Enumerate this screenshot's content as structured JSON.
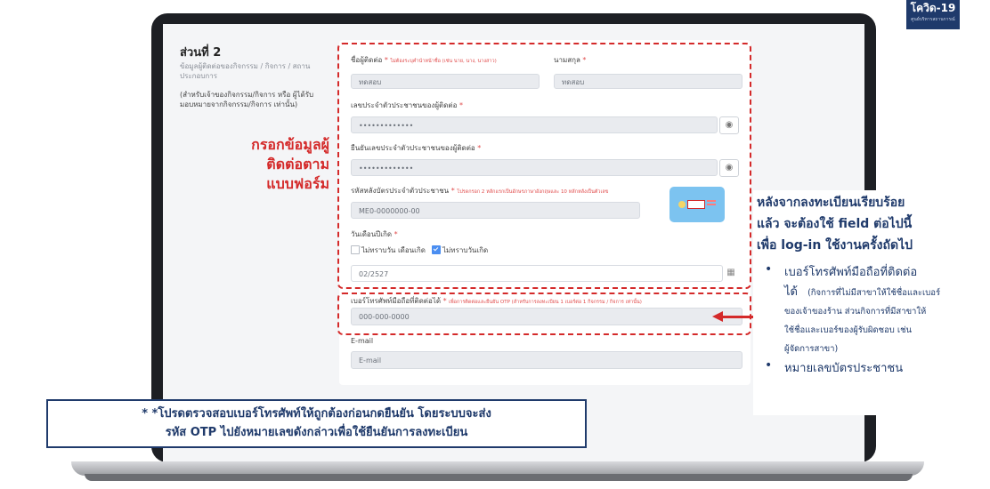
{
  "badge": {
    "title": "โควิด-19",
    "subtitle": "ศูนย์บริหารสถานการณ์"
  },
  "section": {
    "title": "ส่วนที่ 2",
    "description": "ข้อมูลผู้ติดต่อของกิจกรรม / กิจการ / สถานประกอบการ",
    "note": "(สำหรับเจ้าของกิจกรรม/กิจการ หรือ ผู้ได้รับมอบหมายจากกิจกรรม/กิจการ เท่านั้น)"
  },
  "left_annotation": {
    "line1": "กรอกข้อมูลผู้",
    "line2": "ติดต่อตาม",
    "line3": "แบบฟอร์ม"
  },
  "form": {
    "first_name": {
      "label": "ชื่อผู้ติดต่อ",
      "hint": "ไม่ต้องระบุคำนำหน้าชื่อ (เช่น นาย, นาง, นางสาว)",
      "value": "ทดสอบ"
    },
    "last_name": {
      "label": "นามสกุล",
      "value": "ทดสอบ"
    },
    "id_number": {
      "label": "เลขประจำตัวประชาชนของผู้ติดต่อ",
      "value": "•••••••••••••"
    },
    "id_confirm": {
      "label": "ยืนยันเลขประจำตัวประชาชนของผู้ติดต่อ",
      "value": "•••••••••••••"
    },
    "laser_code": {
      "label": "รหัสหลังบัตรประจำตัวประชาชน",
      "hint": "โปรดกรอก 2 หลักแรกเป็นอักษรภาษาอังกฤษและ 10 หลักหลังเป็นตัวเลข",
      "value": "ME0-0000000-00"
    },
    "birthdate": {
      "label": "วันเดือนปีเกิด",
      "opt1": "ไม่ทราบวัน เดือนเกิด",
      "opt2": "ไม่ทราบวันเกิด",
      "value": "02/2527"
    },
    "phone": {
      "label": "เบอร์โทรศัพท์มือถือที่ติดต่อได้",
      "hint": "เพื่อการติดต่อและยืนยัน OTP (สำหรับการลงทะเบียน 1 เบอร์ต่อ 1 กิจกรรม / กิจการ เท่านั้น)",
      "placeholder": "000-000-0000"
    },
    "email": {
      "label": "E-mail",
      "placeholder": "E-mail"
    },
    "required_mark": "*"
  },
  "right_note": {
    "heading": "หลังจากลงทะเบียนเรียบร้อยแล้ว จะต้องใช้ field ต่อไปนี้เพื่อ log-in ใช้งานครั้งถัดไป",
    "heading_l1": "หลังจากลงทะเบียนเรียบร้อย",
    "heading_l2": "แล้ว จะต้องใช้ field ต่อไปนี้",
    "heading_l3": "เพื่อ log-in ใช้งานครั้งถัดไป",
    "item1": "เบอร์โทรศัพท์มือถือที่ติดต่อได้",
    "item1_l1": "เบอร์โทรศัพท์มือถือที่ติดต่อ",
    "item1_l2": "ได้",
    "item1_sub1": "(กิจการที่ไม่มีสาขาให้ใช้ชื่อและเบอร์",
    "item1_sub2": "ของเจ้าของร้าน ส่วนกิจการที่มีสาขาให้",
    "item1_sub3": "ใช้ชื่อและเบอร์ของผู้รับผิดชอบ เช่น",
    "item1_sub4": "ผู้จัดการสาขา)",
    "item2": "หมายเลขบัตรประชาชน"
  },
  "warning": {
    "line1": "* *โปรดตรวจสอบเบอร์โทรศัพท์ให้ถูกต้องก่อนกดยืนยัน โดยระบบจะส่ง",
    "line2": "รหัส OTP ไปยังหมายเลขดังกล่าวเพื่อใช้ยืนยันการลงทะเบียน"
  },
  "colors": {
    "accent_red": "#d42a2a",
    "navy": "#1f3a6b",
    "checkbox_blue": "#4a8ef1"
  },
  "icons": {
    "eye": "eye-icon",
    "calendar": "calendar-icon",
    "arrow": "left-arrow-icon"
  }
}
